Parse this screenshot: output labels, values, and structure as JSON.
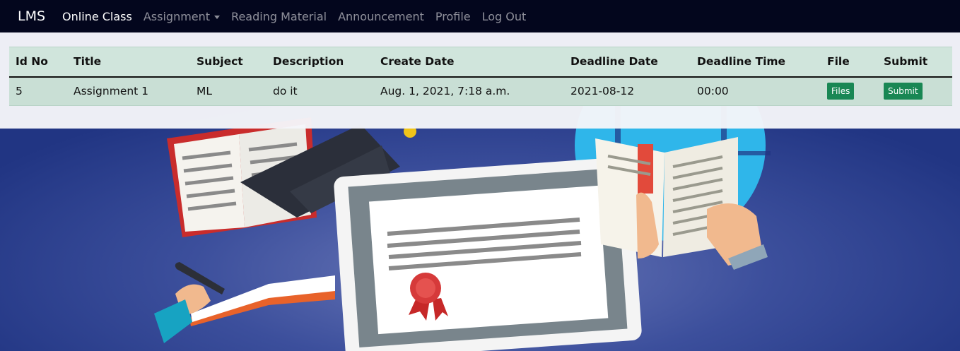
{
  "navbar": {
    "brand": "LMS",
    "items": [
      {
        "label": "Online Class",
        "active": true
      },
      {
        "label": "Assignment",
        "dropdown": true
      },
      {
        "label": "Reading Material"
      },
      {
        "label": "Announcement"
      },
      {
        "label": "Profile"
      },
      {
        "label": "Log Out"
      }
    ]
  },
  "table": {
    "headers": [
      "Id No",
      "Title",
      "Subject",
      "Description",
      "Create Date",
      "Deadline Date",
      "Deadline Time",
      "File",
      "Submit"
    ],
    "rows": [
      {
        "id": "5",
        "title": "Assignment 1",
        "subject": "ML",
        "description": "do it",
        "create_date": "Aug. 1, 2021, 7:18 a.m.",
        "deadline_date": "2021-08-12",
        "deadline_time": "00:00",
        "file_button": "Files",
        "submit_button": "Submit"
      }
    ]
  },
  "colors": {
    "navbar_bg": "#03061d",
    "table_header_bg": "#d0e5dc",
    "table_row_bg": "#c9dfd5",
    "button_green": "#198754",
    "hero_bg": "#2a3c8c"
  },
  "icons": [
    "certificate-illustration",
    "graduation-cap-icon",
    "open-book-icon",
    "globe-icon",
    "pen-icon"
  ]
}
